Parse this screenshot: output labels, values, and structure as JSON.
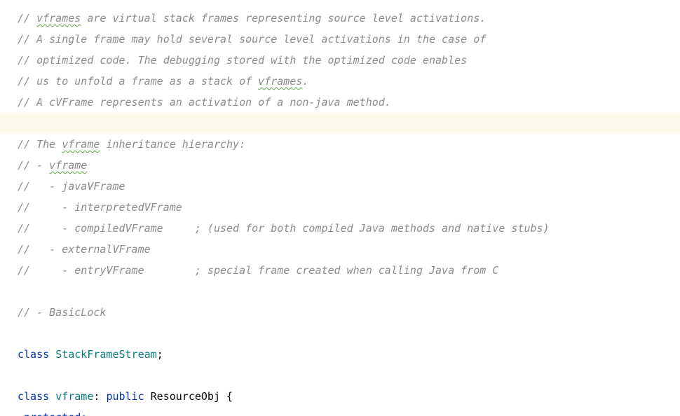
{
  "editor": {
    "lines": [
      {
        "type": "comment",
        "segments": [
          {
            "text": "// ",
            "typo": false
          },
          {
            "text": "vframes",
            "typo": true
          },
          {
            "text": " are virtual stack frames representing source level activations.",
            "typo": false
          }
        ]
      },
      {
        "type": "comment",
        "segments": [
          {
            "text": "// A single frame may hold several source level activations in the case of",
            "typo": false
          }
        ]
      },
      {
        "type": "comment",
        "segments": [
          {
            "text": "// optimized code. The debugging stored with the optimized code enables",
            "typo": false
          }
        ]
      },
      {
        "type": "comment",
        "segments": [
          {
            "text": "// us to unfold a frame as a stack of ",
            "typo": false
          },
          {
            "text": "vframes",
            "typo": true
          },
          {
            "text": ".",
            "typo": false
          }
        ]
      },
      {
        "type": "comment",
        "segments": [
          {
            "text": "// A cVFrame represents an activation of a non-java method.",
            "typo": false
          }
        ]
      },
      {
        "type": "blank",
        "current": true,
        "segments": []
      },
      {
        "type": "comment",
        "segments": [
          {
            "text": "// The ",
            "typo": false
          },
          {
            "text": "vframe",
            "typo": true
          },
          {
            "text": " inheritance hierarchy:",
            "typo": false
          }
        ]
      },
      {
        "type": "comment",
        "segments": [
          {
            "text": "// - ",
            "typo": false
          },
          {
            "text": "vframe",
            "typo": true
          }
        ]
      },
      {
        "type": "comment",
        "segments": [
          {
            "text": "//   - javaVFrame",
            "typo": false
          }
        ]
      },
      {
        "type": "comment",
        "segments": [
          {
            "text": "//     - interpretedVFrame",
            "typo": false
          }
        ]
      },
      {
        "type": "comment",
        "segments": [
          {
            "text": "//     - compiledVFrame     ; (used for both compiled Java methods and native stubs)",
            "typo": false
          }
        ]
      },
      {
        "type": "comment",
        "segments": [
          {
            "text": "//   - externalVFrame",
            "typo": false
          }
        ]
      },
      {
        "type": "comment",
        "segments": [
          {
            "text": "//     - entryVFrame        ; special frame created when calling Java from C",
            "typo": false
          }
        ]
      },
      {
        "type": "blank",
        "segments": []
      },
      {
        "type": "comment",
        "segments": [
          {
            "text": "// - BasicLock",
            "typo": false
          }
        ]
      },
      {
        "type": "blank",
        "segments": []
      },
      {
        "type": "code",
        "segments": [
          {
            "text": "class",
            "style": "kw"
          },
          {
            "text": " ",
            "style": "plain"
          },
          {
            "text": "StackFrameStream",
            "style": "cls"
          },
          {
            "text": ";",
            "style": "plain"
          }
        ]
      },
      {
        "type": "blank",
        "segments": []
      },
      {
        "type": "code",
        "segments": [
          {
            "text": "class",
            "style": "kw"
          },
          {
            "text": " ",
            "style": "plain"
          },
          {
            "text": "vframe",
            "style": "cls"
          },
          {
            "text": ": ",
            "style": "plain"
          },
          {
            "text": "public",
            "style": "kw"
          },
          {
            "text": " ResourceObj {",
            "style": "plain"
          }
        ]
      }
    ],
    "partial_line": " protected:"
  }
}
